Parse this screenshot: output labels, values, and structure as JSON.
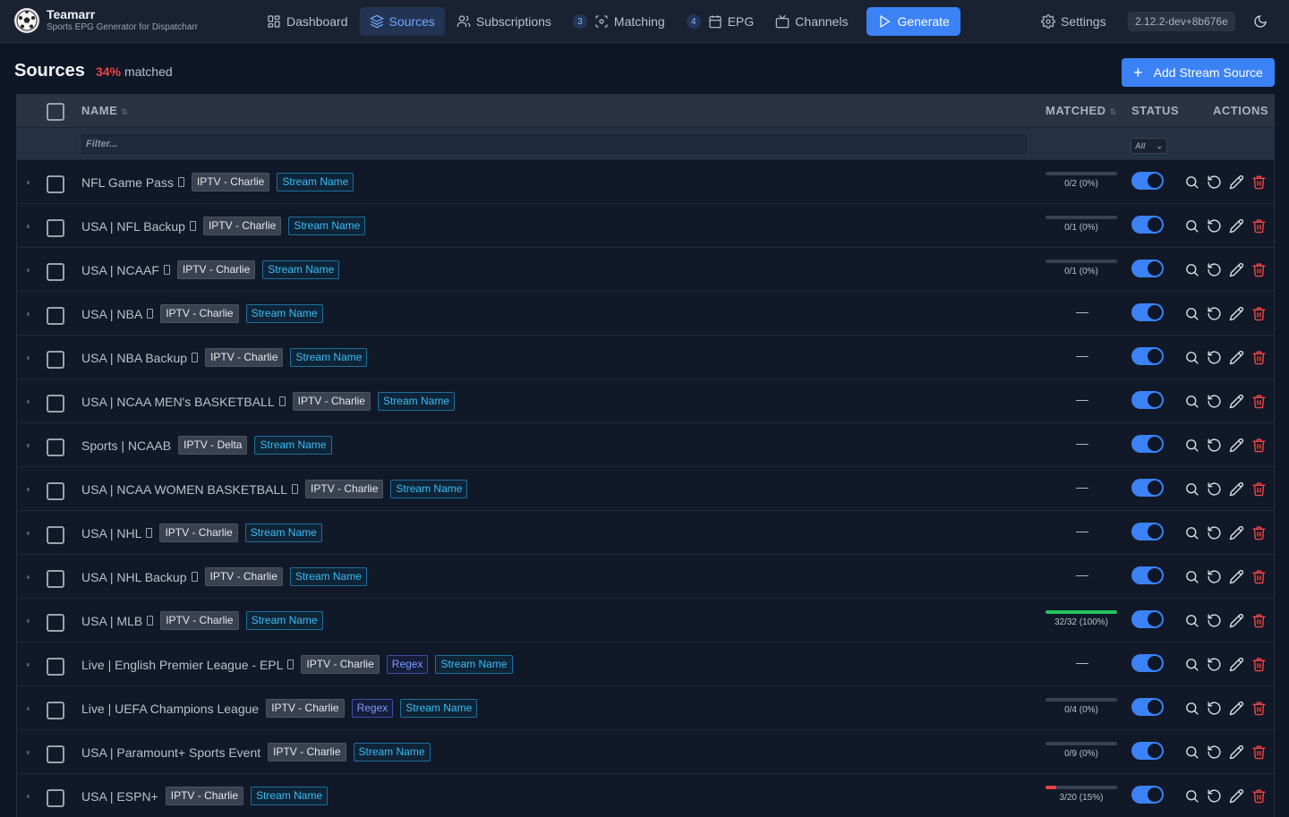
{
  "app": {
    "name": "Teamarr",
    "subtitle": "Sports EPG Generator for Dispatcharr",
    "version": "2.12.2-dev+8b676e"
  },
  "nav": {
    "dashboard": "Dashboard",
    "sources": "Sources",
    "subscriptions": "Subscriptions",
    "matching_badge": "3",
    "matching": "Matching",
    "epg_badge": "4",
    "epg": "EPG",
    "channels": "Channels",
    "generate": "Generate",
    "settings": "Settings"
  },
  "page": {
    "title": "Sources",
    "match_pct": "34%",
    "match_label": "matched",
    "add_button": "Add Stream Source"
  },
  "table": {
    "headers": {
      "name": "NAME",
      "matched": "MATCHED",
      "status": "STATUS",
      "actions": "ACTIONS"
    },
    "filter_placeholder": "Filter...",
    "status_filter": "All",
    "rows": [
      {
        "name": "NFL Game Pass",
        "icon": true,
        "account": "IPTV - Charlie",
        "tags": [
          "Stream Name"
        ],
        "matched": "0/2 (0%)",
        "progress": 0,
        "enabled": true
      },
      {
        "name": "USA | NFL Backup",
        "icon": true,
        "account": "IPTV - Charlie",
        "tags": [
          "Stream Name"
        ],
        "matched": "0/1 (0%)",
        "progress": 0,
        "enabled": true
      },
      {
        "name": "USA | NCAAF",
        "icon": true,
        "account": "IPTV - Charlie",
        "tags": [
          "Stream Name"
        ],
        "matched": "0/1 (0%)",
        "progress": 0,
        "enabled": true
      },
      {
        "name": "USA | NBA",
        "icon": true,
        "account": "IPTV - Charlie",
        "tags": [
          "Stream Name"
        ],
        "matched": "—",
        "progress": null,
        "enabled": true
      },
      {
        "name": "USA | NBA Backup",
        "icon": true,
        "account": "IPTV - Charlie",
        "tags": [
          "Stream Name"
        ],
        "matched": "—",
        "progress": null,
        "enabled": true
      },
      {
        "name": "USA | NCAA MEN's BASKETBALL",
        "icon": true,
        "account": "IPTV - Charlie",
        "tags": [
          "Stream Name"
        ],
        "matched": "—",
        "progress": null,
        "enabled": true
      },
      {
        "name": "Sports | NCAAB",
        "icon": false,
        "account": "IPTV - Delta",
        "tags": [
          "Stream Name"
        ],
        "matched": "—",
        "progress": null,
        "enabled": true
      },
      {
        "name": "USA | NCAA WOMEN BASKETBALL",
        "icon": true,
        "account": "IPTV - Charlie",
        "tags": [
          "Stream Name"
        ],
        "matched": "—",
        "progress": null,
        "enabled": true
      },
      {
        "name": "USA | NHL",
        "icon": true,
        "account": "IPTV - Charlie",
        "tags": [
          "Stream Name"
        ],
        "matched": "—",
        "progress": null,
        "enabled": true
      },
      {
        "name": "USA | NHL Backup",
        "icon": true,
        "account": "IPTV - Charlie",
        "tags": [
          "Stream Name"
        ],
        "matched": "—",
        "progress": null,
        "enabled": true
      },
      {
        "name": "USA | MLB",
        "icon": true,
        "account": "IPTV - Charlie",
        "tags": [
          "Stream Name"
        ],
        "matched": "32/32 (100%)",
        "progress": 1.0,
        "enabled": true
      },
      {
        "name": "Live | English Premier League - EPL",
        "icon": true,
        "account": "IPTV - Charlie",
        "tags": [
          "Regex",
          "Stream Name"
        ],
        "matched": "—",
        "progress": null,
        "enabled": true
      },
      {
        "name": "Live | UEFA Champions League",
        "icon": false,
        "account": "IPTV - Charlie",
        "tags": [
          "Regex",
          "Stream Name"
        ],
        "matched": "0/4 (0%)",
        "progress": 0,
        "enabled": true
      },
      {
        "name": "USA | Paramount+ Sports Event",
        "icon": false,
        "account": "IPTV - Charlie",
        "tags": [
          "Stream Name"
        ],
        "matched": "0/9 (0%)",
        "progress": 0,
        "enabled": true
      },
      {
        "name": "USA | ESPN+",
        "icon": false,
        "account": "IPTV - Charlie",
        "tags": [
          "Stream Name"
        ],
        "matched": "3/20 (15%)",
        "progress": 0.15,
        "enabled": true
      }
    ]
  },
  "colors": {
    "accent": "#3b82f6",
    "danger": "#ef4444",
    "success": "#22c55e",
    "background": "#0f1625"
  },
  "icons": [
    "dashboard-icon",
    "layers-icon",
    "users-icon",
    "scan-icon",
    "calendar-icon",
    "tv-icon",
    "play-icon",
    "gear-icon",
    "moon-icon",
    "search-icon",
    "refresh-icon",
    "pencil-icon",
    "trash-icon"
  ]
}
